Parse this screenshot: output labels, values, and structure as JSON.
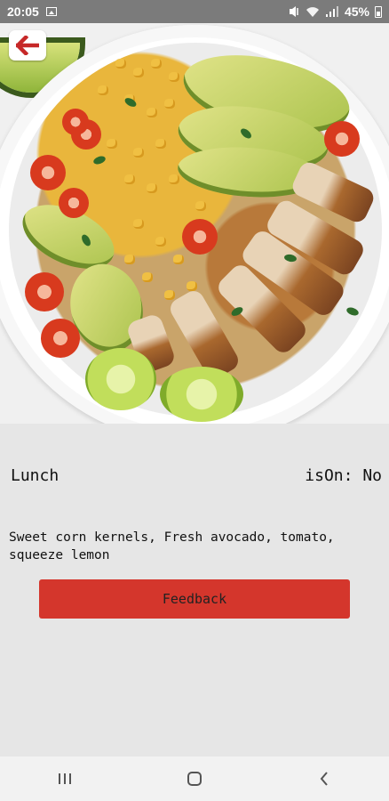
{
  "status_bar": {
    "time": "20:05",
    "battery": "45%"
  },
  "recipe": {
    "meal": "Lunch",
    "is_on_label": "isOn: No",
    "ingredients": "Sweet corn kernels, Fresh avocado, tomato, squeeze lemon"
  },
  "actions": {
    "feedback_label": "Feedback"
  },
  "icons": {
    "back": "arrow-left-icon",
    "recents": "recents-icon",
    "home": "home-icon",
    "back_nav": "chevron-left-icon"
  },
  "colors": {
    "accent": "#d4362c",
    "back_arrow": "#c62828"
  }
}
